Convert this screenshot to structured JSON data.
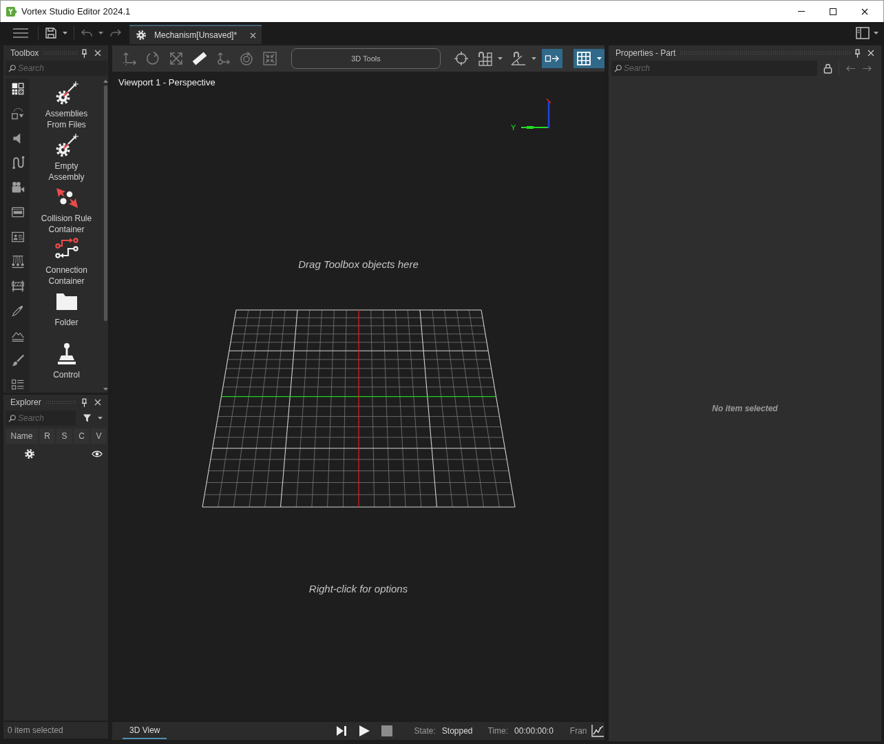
{
  "window": {
    "title": "Vortex Studio Editor 2024.1"
  },
  "document_tabs": [
    {
      "label": "Mechanism[Unsaved]*",
      "selected": true
    }
  ],
  "toolbox": {
    "title": "Toolbox",
    "search": {
      "placeholder": "Search"
    },
    "categories": [
      {
        "selected": true
      },
      {
        "selected": false
      },
      {
        "selected": false
      },
      {
        "selected": false
      },
      {
        "selected": false
      },
      {
        "selected": false
      },
      {
        "selected": false
      },
      {
        "selected": false
      },
      {
        "selected": false
      },
      {
        "selected": false
      },
      {
        "selected": false
      },
      {
        "selected": false
      },
      {
        "selected": false
      }
    ],
    "items": [
      {
        "label": "Assemblies From Files"
      },
      {
        "label": "Empty Assembly"
      },
      {
        "label": "Collision Rule Container"
      },
      {
        "label": "Connection Container"
      },
      {
        "label": "Folder"
      },
      {
        "label": "Control"
      }
    ]
  },
  "explorer": {
    "title": "Explorer",
    "search": {
      "placeholder": "Search"
    },
    "columns": [
      "Name",
      "R",
      "S",
      "C",
      "V"
    ],
    "rows": [
      {
        "visible": true
      }
    ],
    "status": "0 item selected"
  },
  "toolbar": {
    "tools": [
      {
        "disabled": true
      },
      {
        "disabled": true
      },
      {
        "disabled": true
      },
      {
        "disabled": false
      },
      {
        "disabled": true
      },
      {
        "disabled": true
      },
      {
        "disabled": true
      }
    ],
    "tools_menu": "3D Tools",
    "toggles": [
      {
        "on": false,
        "menu": false
      },
      {
        "on": false,
        "menu": true
      },
      {
        "on": false,
        "menu": true
      },
      {
        "on": true,
        "menu": false
      },
      {
        "on": true,
        "menu": true
      }
    ]
  },
  "viewport": {
    "title": "Viewport 1 - Perspective",
    "drop_hint": "Drag Toolbox objects here",
    "context_hint": "Right-click for options",
    "axis_label": "Y"
  },
  "bottom_bar": {
    "tabs": [
      {
        "label": "3D View",
        "selected": true
      }
    ],
    "state_label": "State:",
    "state_value": "Stopped",
    "time_label": "Time:",
    "time_value": "00:00:00:0",
    "frame_label": "Fran"
  },
  "properties": {
    "title": "Properties - Part",
    "search": {
      "placeholder": "Search"
    },
    "empty_message": "No item selected"
  }
}
